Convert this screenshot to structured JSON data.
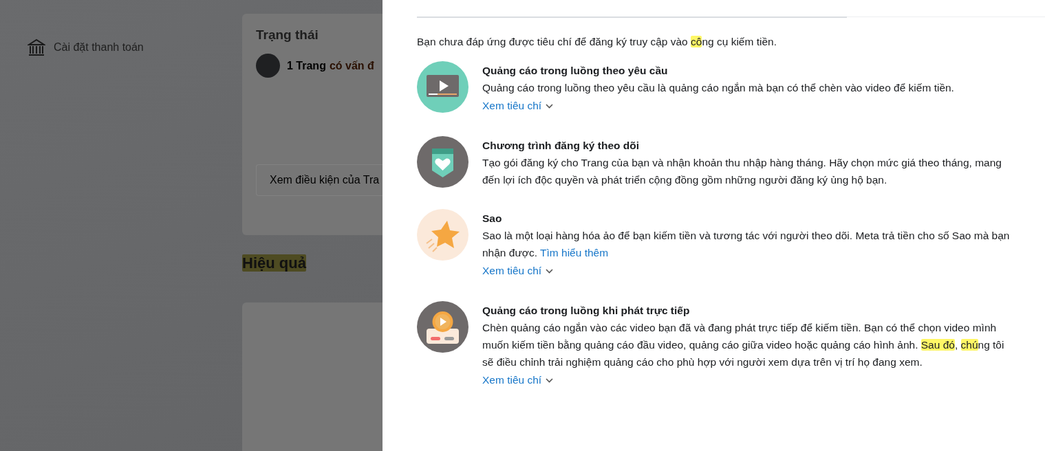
{
  "sidebar": {
    "items": [
      {
        "label": "Cài đặt thanh toán"
      }
    ]
  },
  "status_card": {
    "title": "Trạng thái",
    "page_count": "1 Trang",
    "issue": "có vấn đ",
    "conditions_button": "Xem điều kiện của Tra"
  },
  "section_heading": {
    "segments": [
      {
        "text": "Hiệu quả",
        "highlighted": true
      }
    ]
  },
  "panel": {
    "intro": [
      {
        "text": "Bạn chưa đáp ứng được tiêu chí để đăng ký truy cập vào ",
        "highlighted": false
      },
      {
        "text": "cô",
        "highlighted": true
      },
      {
        "text": "ng cụ kiếm tiền.",
        "highlighted": false
      }
    ],
    "tools": [
      {
        "kind": "video",
        "title": "Quảng cáo trong luồng theo yêu cầu",
        "description": [
          {
            "text": "Quảng cáo trong luồng theo yêu cầu là quảng cáo ngắn mà bạn có thể chèn vào video để kiếm tiền.",
            "highlighted": false
          }
        ],
        "criteria_link": "Xem tiêu chí"
      },
      {
        "kind": "subscription",
        "title": "Chương trình đăng ký theo dõi",
        "description": [
          {
            "text": "Tạo gói đăng ký cho Trang của bạn và nhận khoản thu nhập hàng tháng. Hãy chọn mức giá theo tháng, mang đến lợi ích độc quyền và phát triển cộng đồng gồm những người đăng ký ủng hộ bạn.",
            "highlighted": false
          }
        ]
      },
      {
        "kind": "stars",
        "title": "Sao",
        "description": [
          {
            "text": "Sao là một loại hàng hóa ảo để bạn kiếm tiền và tương tác với người theo dõi. Meta trả tiền cho số Sao mà bạn nhận được. ",
            "highlighted": false
          }
        ],
        "learn_more": "Tìm hiểu thêm",
        "criteria_link": "Xem tiêu chí"
      },
      {
        "kind": "live",
        "title": "Quảng cáo trong luồng khi phát trực tiếp",
        "description": [
          {
            "text": "Chèn quảng cáo ngắn vào các video bạn đã và đang phát trực tiếp để kiếm tiền. Bạn có thể chọn video mình muốn kiếm tiền bằng quảng cáo đầu video, quảng cáo giữa video hoặc quảng cáo hình ảnh. ",
            "highlighted": false
          },
          {
            "text": "Sau đó",
            "highlighted": true
          },
          {
            "text": ", ",
            "highlighted": false
          },
          {
            "text": "chú",
            "highlighted": true
          },
          {
            "text": "ng tôi sẽ điều chỉnh trải nghiệm quảng cáo cho phù hợp với người xem dựa trên vị trí họ đang xem.",
            "highlighted": false
          }
        ],
        "criteria_link": "Xem tiêu chí"
      }
    ]
  }
}
